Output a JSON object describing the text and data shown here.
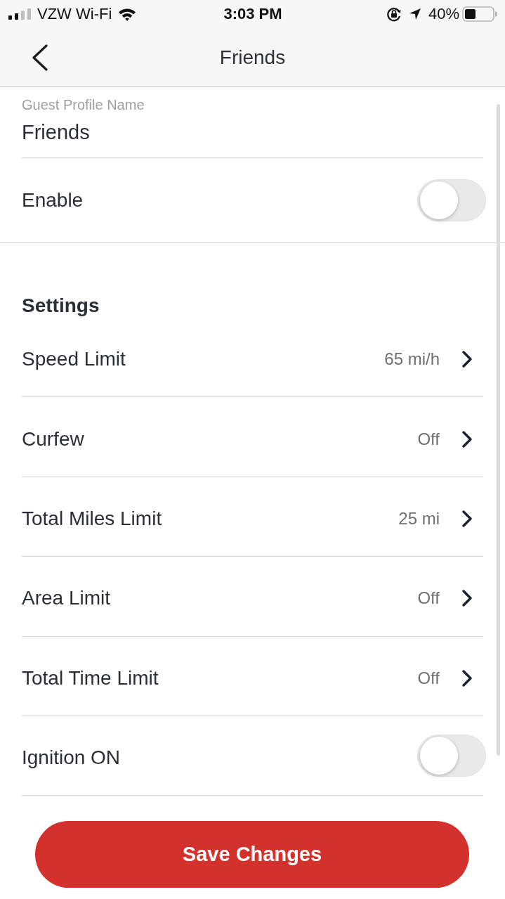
{
  "status_bar": {
    "carrier": "VZW Wi-Fi",
    "time": "3:03 PM",
    "battery": "40%"
  },
  "nav_bar": {
    "title": "Friends"
  },
  "profile_name_field": {
    "label": "Guest Profile Name",
    "value": "Friends"
  },
  "enable": {
    "label": "Enable",
    "on": false
  },
  "settings": {
    "heading": "Settings",
    "rows": [
      {
        "kind": "link",
        "label": "Speed Limit",
        "value": "65 mi/h"
      },
      {
        "kind": "link",
        "label": "Curfew",
        "value": "Off"
      },
      {
        "kind": "link",
        "label": "Total Miles Limit",
        "value": "25 mi"
      },
      {
        "kind": "link",
        "label": "Area Limit",
        "value": "Off"
      },
      {
        "kind": "link",
        "label": "Total Time Limit",
        "value": "Off"
      },
      {
        "kind": "toggle",
        "label": "Ignition ON",
        "on": false
      }
    ]
  },
  "save_button": {
    "label": "Save Changes"
  }
}
